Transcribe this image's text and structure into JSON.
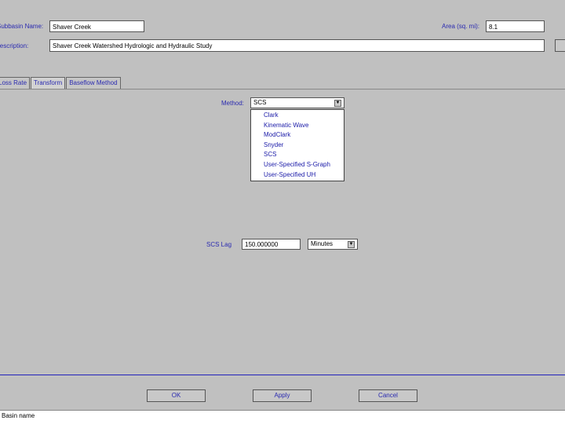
{
  "header": {
    "subbasin_label": "Subbasin Name:",
    "subbasin_value": "Shaver Creek",
    "area_label": "Area (sq. mi):",
    "area_value": "8.1",
    "description_label": "Description:",
    "description_value": "Shaver Creek Watershed Hydrologic and Hydraulic Study"
  },
  "tabs": [
    {
      "label": "Loss Rate"
    },
    {
      "label": "Transform"
    },
    {
      "label": "Baseflow Method"
    }
  ],
  "method": {
    "label": "Method:",
    "selected": "SCS",
    "options": [
      "Clark",
      "Kinematic Wave",
      "ModClark",
      "Snyder",
      "SCS",
      "User-Specified S-Graph",
      "User-Specified UH"
    ]
  },
  "lag": {
    "label": "SCS Lag",
    "value": "150.000000",
    "unit": "Minutes"
  },
  "buttons": {
    "ok": "OK",
    "apply": "Apply",
    "cancel": "Cancel"
  },
  "status": {
    "text": "Basin name"
  },
  "colors": {
    "background": "#c0c0c0",
    "label_text": "#2a2ab0",
    "divider": "#2222bb"
  }
}
